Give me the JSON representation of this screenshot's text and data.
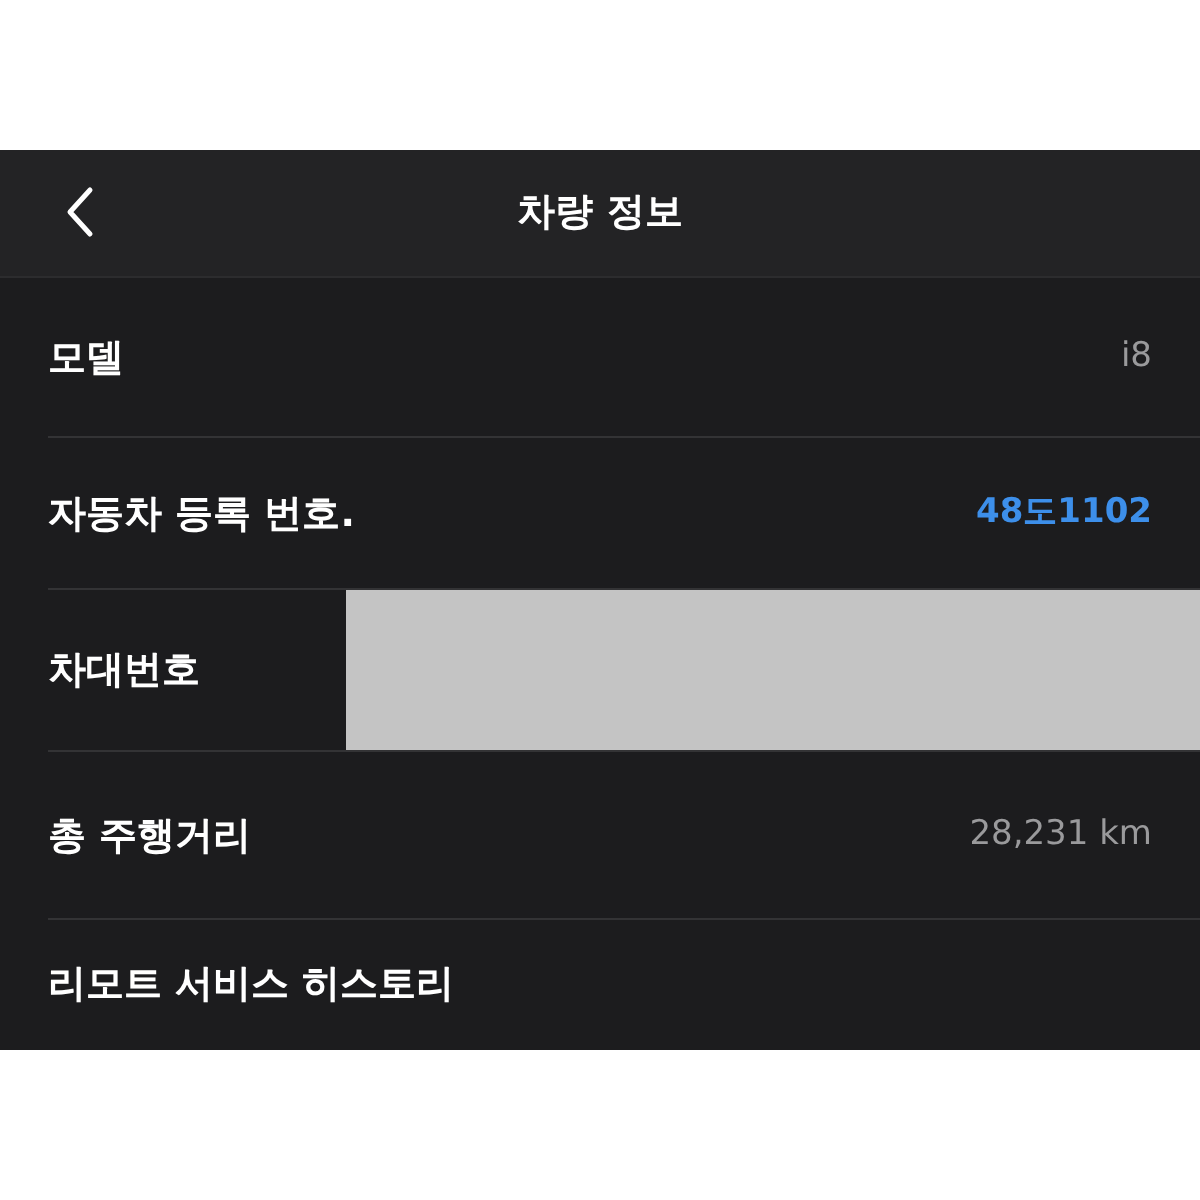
{
  "header": {
    "title": "차량 정보"
  },
  "rows": [
    {
      "label": "모델",
      "kind": "text",
      "value": "i8"
    },
    {
      "label": "자동차 등록 번호.",
      "kind": "link",
      "value": "48도1102"
    },
    {
      "label": "차대번호",
      "kind": "redacted"
    },
    {
      "label": "총 주행거리",
      "kind": "text",
      "value": "28,231 km"
    },
    {
      "label": "리모트 서비스 히스토리",
      "kind": "none"
    }
  ]
}
